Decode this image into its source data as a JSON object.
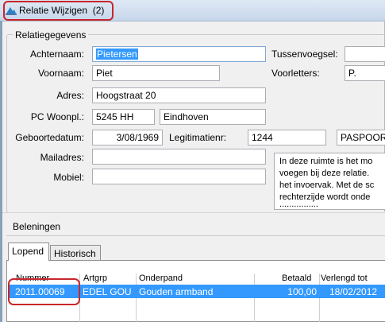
{
  "window": {
    "title": "Relatie Wijzigen",
    "count": "(2)"
  },
  "relatie": {
    "group_title": "Relatiegegevens",
    "labels": {
      "achternaam": "Achternaam:",
      "tussenvoegsel": "Tussenvoegsel:",
      "voornaam": "Voornaam:",
      "voorletters": "Voorletters:",
      "adres": "Adres:",
      "pc_woonpl": "PC Woonpl.:",
      "geboortedatum": "Geboortedatum:",
      "legitimatienr": "Legitimatienr:",
      "mailadres": "Mailadres:",
      "mobiel": "Mobiel:"
    },
    "values": {
      "achternaam": "Pietersen",
      "tussenvoegsel": "",
      "voornaam": "Piet",
      "voorletters": "P.",
      "adres": "Hoogstraat 20",
      "postcode": "5245 HH",
      "woonplaats": "Eindhoven",
      "geboortedatum": "3/08/1969",
      "legitimatienr": "1244",
      "legitimatie_type": "PASPOOR",
      "mailadres": "",
      "mobiel": ""
    },
    "memo_lines": [
      "In deze ruimte is het mo",
      "voegen bij deze relatie.",
      "het invoervak. Met de sc",
      "rechterzijde wordt onde",
      "................"
    ]
  },
  "beleningen": {
    "group_title": "Beleningen",
    "tabs": [
      {
        "label": "Lopend"
      },
      {
        "label": "Historisch"
      }
    ],
    "columns": [
      "Nummer",
      "Artgrp",
      "Onderpand",
      "Betaald",
      "Verlengd tot"
    ],
    "rows": [
      {
        "nummer": "2011.00069",
        "artgrp": "EDEL GOU",
        "onderpand": "Gouden armband",
        "betaald": "100,00",
        "verlengd_tot": "18/02/2012"
      }
    ]
  },
  "colors": {
    "highlight": "#c8262b",
    "selection": "#3399ff"
  }
}
